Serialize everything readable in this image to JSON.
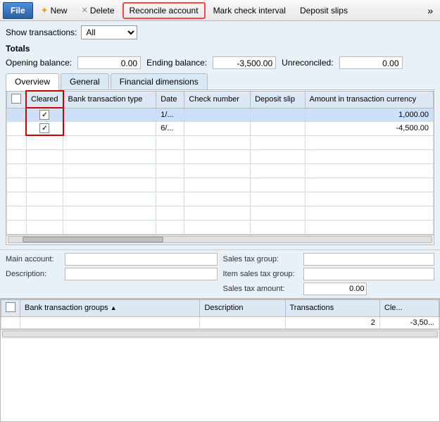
{
  "toolbar": {
    "file_label": "File",
    "new_label": "New",
    "delete_label": "Delete",
    "reconcile_label": "Reconcile account",
    "mark_check_label": "Mark check interval",
    "deposit_slips_label": "Deposit slips",
    "more_label": "»"
  },
  "filters": {
    "show_transactions_label": "Show transactions:",
    "show_transactions_value": "All"
  },
  "totals": {
    "title": "Totals",
    "opening_balance_label": "Opening balance:",
    "opening_balance_value": "0.00",
    "ending_balance_label": "Ending balance:",
    "ending_balance_value": "-3,500.00",
    "unreconciled_label": "Unreconciled:",
    "unreconciled_value": "0.00"
  },
  "tabs": [
    {
      "label": "Overview",
      "active": true
    },
    {
      "label": "General",
      "active": false
    },
    {
      "label": "Financial dimensions",
      "active": false
    }
  ],
  "table": {
    "columns": [
      {
        "key": "cleared",
        "label": "Cleared"
      },
      {
        "key": "bank_transaction_type",
        "label": "Bank transaction type"
      },
      {
        "key": "date",
        "label": "Date"
      },
      {
        "key": "check_number",
        "label": "Check number"
      },
      {
        "key": "deposit_slip",
        "label": "Deposit slip"
      },
      {
        "key": "amount",
        "label": "Amount in transaction currency"
      }
    ],
    "rows": [
      {
        "cleared": true,
        "bank_transaction_type": "",
        "date": "1/...",
        "check_number": "",
        "deposit_slip": "",
        "amount": "1,000.00",
        "selected": true
      },
      {
        "cleared": true,
        "bank_transaction_type": "",
        "date": "6/...",
        "check_number": "",
        "deposit_slip": "",
        "amount": "-4,500.00",
        "selected": false
      }
    ]
  },
  "details": {
    "main_account_label": "Main account:",
    "main_account_value": "",
    "description_label": "Description:",
    "description_value": "",
    "sales_tax_group_label": "Sales tax group:",
    "sales_tax_group_value": "",
    "item_sales_tax_group_label": "Item sales tax group:",
    "item_sales_tax_group_value": "",
    "sales_tax_amount_label": "Sales tax amount:",
    "sales_tax_amount_value": "0.00"
  },
  "bottom_table": {
    "columns": [
      {
        "key": "bank_transaction_groups",
        "label": "Bank transaction groups",
        "sort": "asc"
      },
      {
        "key": "description",
        "label": "Description"
      },
      {
        "key": "transactions",
        "label": "Transactions"
      },
      {
        "key": "cleared",
        "label": "Cle..."
      }
    ],
    "rows": [
      {
        "bank_transaction_groups": "",
        "description": "",
        "transactions": "2",
        "cleared": "-3,50..."
      }
    ]
  }
}
